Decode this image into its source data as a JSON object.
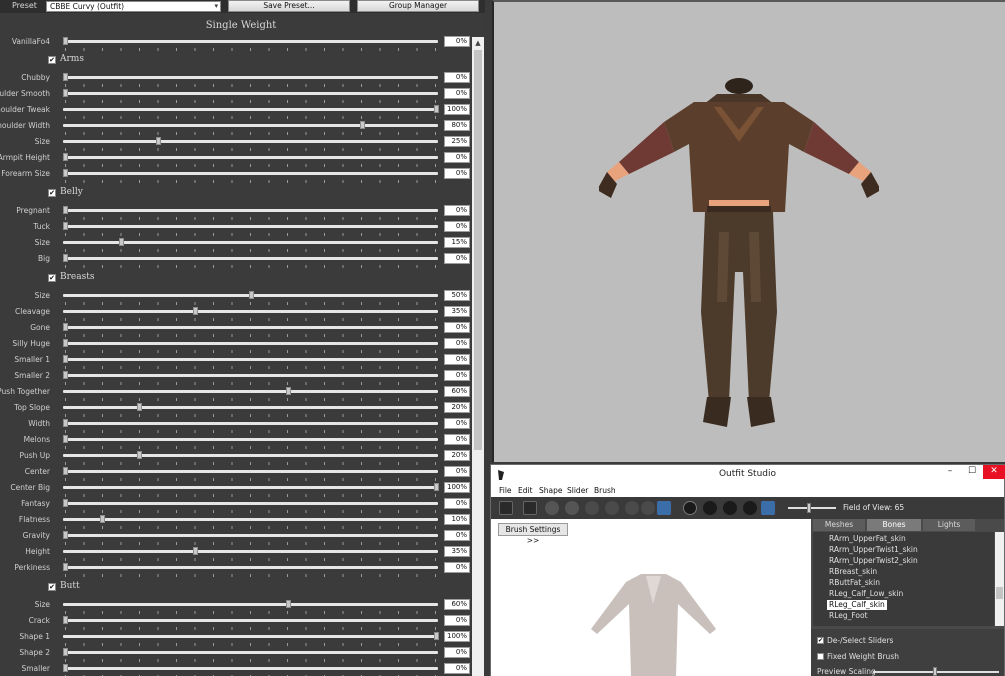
{
  "preset_bar": {
    "label": "Preset",
    "selected": "CBBE Curvy (Outfit)",
    "save_label": "Save Preset...",
    "group_label": "Group Manager"
  },
  "section_title": "Single Weight",
  "top_slider": {
    "label": "VanillaFo4",
    "value": "0%",
    "level": 0
  },
  "groups": [
    {
      "name": "Arms",
      "checked": true,
      "sliders": [
        {
          "label": "Chubby",
          "value": "0%",
          "level": 0
        },
        {
          "label": "Shoulder Smooth",
          "value": "0%",
          "level": 0
        },
        {
          "label": "Shoulder Tweak",
          "value": "100%",
          "level": 100
        },
        {
          "label": "Shoulder Width",
          "value": "80%",
          "level": 80
        },
        {
          "label": "Size",
          "value": "25%",
          "level": 25
        },
        {
          "label": "Armpit Height",
          "value": "0%",
          "level": 0
        },
        {
          "label": "Forearm Size",
          "value": "0%",
          "level": 0
        }
      ]
    },
    {
      "name": "Belly",
      "checked": true,
      "sliders": [
        {
          "label": "Pregnant",
          "value": "0%",
          "level": 0
        },
        {
          "label": "Tuck",
          "value": "0%",
          "level": 0
        },
        {
          "label": "Size",
          "value": "15%",
          "level": 15
        },
        {
          "label": "Big",
          "value": "0%",
          "level": 0
        }
      ]
    },
    {
      "name": "Breasts",
      "checked": true,
      "sliders": [
        {
          "label": "Size",
          "value": "50%",
          "level": 50
        },
        {
          "label": "Cleavage",
          "value": "35%",
          "level": 35
        },
        {
          "label": "Gone",
          "value": "0%",
          "level": 0
        },
        {
          "label": "Silly Huge",
          "value": "0%",
          "level": 0
        },
        {
          "label": "Smaller 1",
          "value": "0%",
          "level": 0
        },
        {
          "label": "Smaller 2",
          "value": "0%",
          "level": 0
        },
        {
          "label": "Push Together",
          "value": "60%",
          "level": 60
        },
        {
          "label": "Top Slope",
          "value": "20%",
          "level": 20
        },
        {
          "label": "Width",
          "value": "0%",
          "level": 0
        },
        {
          "label": "Melons",
          "value": "0%",
          "level": 0
        },
        {
          "label": "Push Up",
          "value": "20%",
          "level": 20
        },
        {
          "label": "Center",
          "value": "0%",
          "level": 0
        },
        {
          "label": "Center Big",
          "value": "100%",
          "level": 100
        },
        {
          "label": "Fantasy",
          "value": "0%",
          "level": 0
        },
        {
          "label": "Flatness",
          "value": "10%",
          "level": 10
        },
        {
          "label": "Gravity",
          "value": "0%",
          "level": 0
        },
        {
          "label": "Height",
          "value": "35%",
          "level": 35
        },
        {
          "label": "Perkiness",
          "value": "0%",
          "level": 0
        }
      ]
    },
    {
      "name": "Butt",
      "checked": true,
      "sliders": [
        {
          "label": "Size",
          "value": "60%",
          "level": 60
        },
        {
          "label": "Crack",
          "value": "0%",
          "level": 0
        },
        {
          "label": "Shape 1",
          "value": "100%",
          "level": 100
        },
        {
          "label": "Shape 2",
          "value": "0%",
          "level": 0
        },
        {
          "label": "Smaller",
          "value": "0%",
          "level": 0
        }
      ]
    }
  ],
  "outfit_studio": {
    "title": "Outfit Studio",
    "window_controls": {
      "minimize": "–",
      "maximize": "☐",
      "close": "✕"
    },
    "menu": [
      "File",
      "Edit",
      "Shape",
      "Slider",
      "Brush"
    ],
    "fov_label": "Field of View: 65",
    "brush_settings": "Brush Settings >>",
    "tabs": [
      "Meshes",
      "Bones",
      "Lights"
    ],
    "active_tab": "Bones",
    "bones": [
      "RArm_UpperFat_skin",
      "RArm_UpperTwist1_skin",
      "RArm_UpperTwist2_skin",
      "RBreast_skin",
      "RButtFat_skin",
      "RLeg_Calf_Low_skin",
      "RLeg_Calf_skin",
      "RLeg_Foot"
    ],
    "selected_bone": "RLeg_Calf_skin",
    "options": [
      {
        "label": "De-/Select Sliders",
        "checked": true
      },
      {
        "label": "Fixed Weight Brush",
        "checked": false
      }
    ],
    "preview_scaling_label": "Preview Scaling"
  },
  "colors": {
    "panel": "#3b3b3b",
    "viewport": "#bdbdbd",
    "close": "#e81123",
    "outfit_brown": "#5a3f2a",
    "shirt_red": "#6e3a33"
  }
}
